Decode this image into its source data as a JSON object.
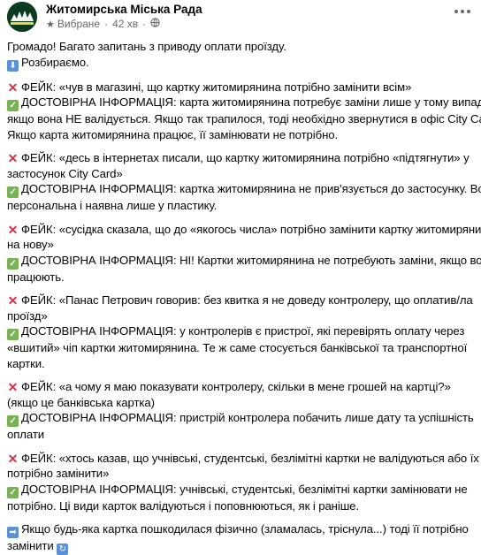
{
  "header": {
    "page_name": "Житомирська Міська Рада",
    "favorites_label": "Вибране",
    "time": "42 хв",
    "more_icon": "three-dots-icon"
  },
  "post": {
    "icons": {
      "fake": "cross-mark-icon",
      "true": "check-mark-icon",
      "down": "down-arrow-icon",
      "right": "right-arrow-icon",
      "repeat": "repeat-icon"
    },
    "intro": [
      "Громадо! Багато запитань з приводу оплати проїзду.",
      "Розбираємо."
    ],
    "blocks": [
      [
        "ФЕЙК: «чув в магазині, що картку житомирянина потрібно замінити всім»",
        "ДОСТОВІРНА ІНФОРМАЦІЯ: карта житомирянина потребує заміни лише у тому випадку,",
        "якщо вона НЕ валідується. Якщо так трапилося, тоді необхідно звернутися в офіс City Card.",
        "Якщо карта житомирянина працює, її замінювати не потрібно."
      ],
      [
        "ФЕЙК: «десь в інтернетах писали, що картку житомирянина потрібно «підтягнути» у",
        "застосунок City Card»",
        "ДОСТОВІРНА ІНФОРМАЦІЯ: картка житомирянина не прив'язується до застосунку. Вона",
        "персональна і наявна лише у пластику."
      ],
      [
        "ФЕЙК: «сусідка сказала, що до «якогось числа» потрібно замінити картку житомирянина",
        "на нову»",
        "ДОСТОВІРНА ІНФОРМАЦІЯ: НІ! Картки житомирянина не потребують заміни, якщо вони",
        "працюють."
      ],
      [
        "ФЕЙК: «Панас Петрович говорив: без квитка я не доведу контролеру, що оплатив/ла",
        "проїзд»",
        "ДОСТОВІРНА ІНФОРМАЦІЯ: у контролерів є пристрої, які перевірять оплату через",
        "«вшитий» чіп картки житомирянина. Те ж саме стосується банківської та транспортної",
        "картки."
      ],
      [
        "ФЕЙК: «а чому я маю показувати контролеру, скільки в мене грошей на картці?»",
        "(якщо це банківська картка)",
        "ДОСТОВІРНА ІНФОРМАЦІЯ: пристрій контролера побачить лише дату та успішність",
        "оплати"
      ],
      [
        "ФЕЙК: «хтось казав, що учнівські, студентські, безлімітні картки не валідуються або їх",
        "потрібно замінити»",
        "ДОСТОВІРНА ІНФОРМАЦІЯ: учнівські, студентські, безлімітні картки замінювати не",
        "потрібно. Ці види карток валідуються  і поповнюються, як і раніше."
      ],
      [
        "Якщо будь-яка картка пошкодилася фізично (зламалась, тріснула...) тоді її потрібно",
        "замінити"
      ]
    ]
  }
}
